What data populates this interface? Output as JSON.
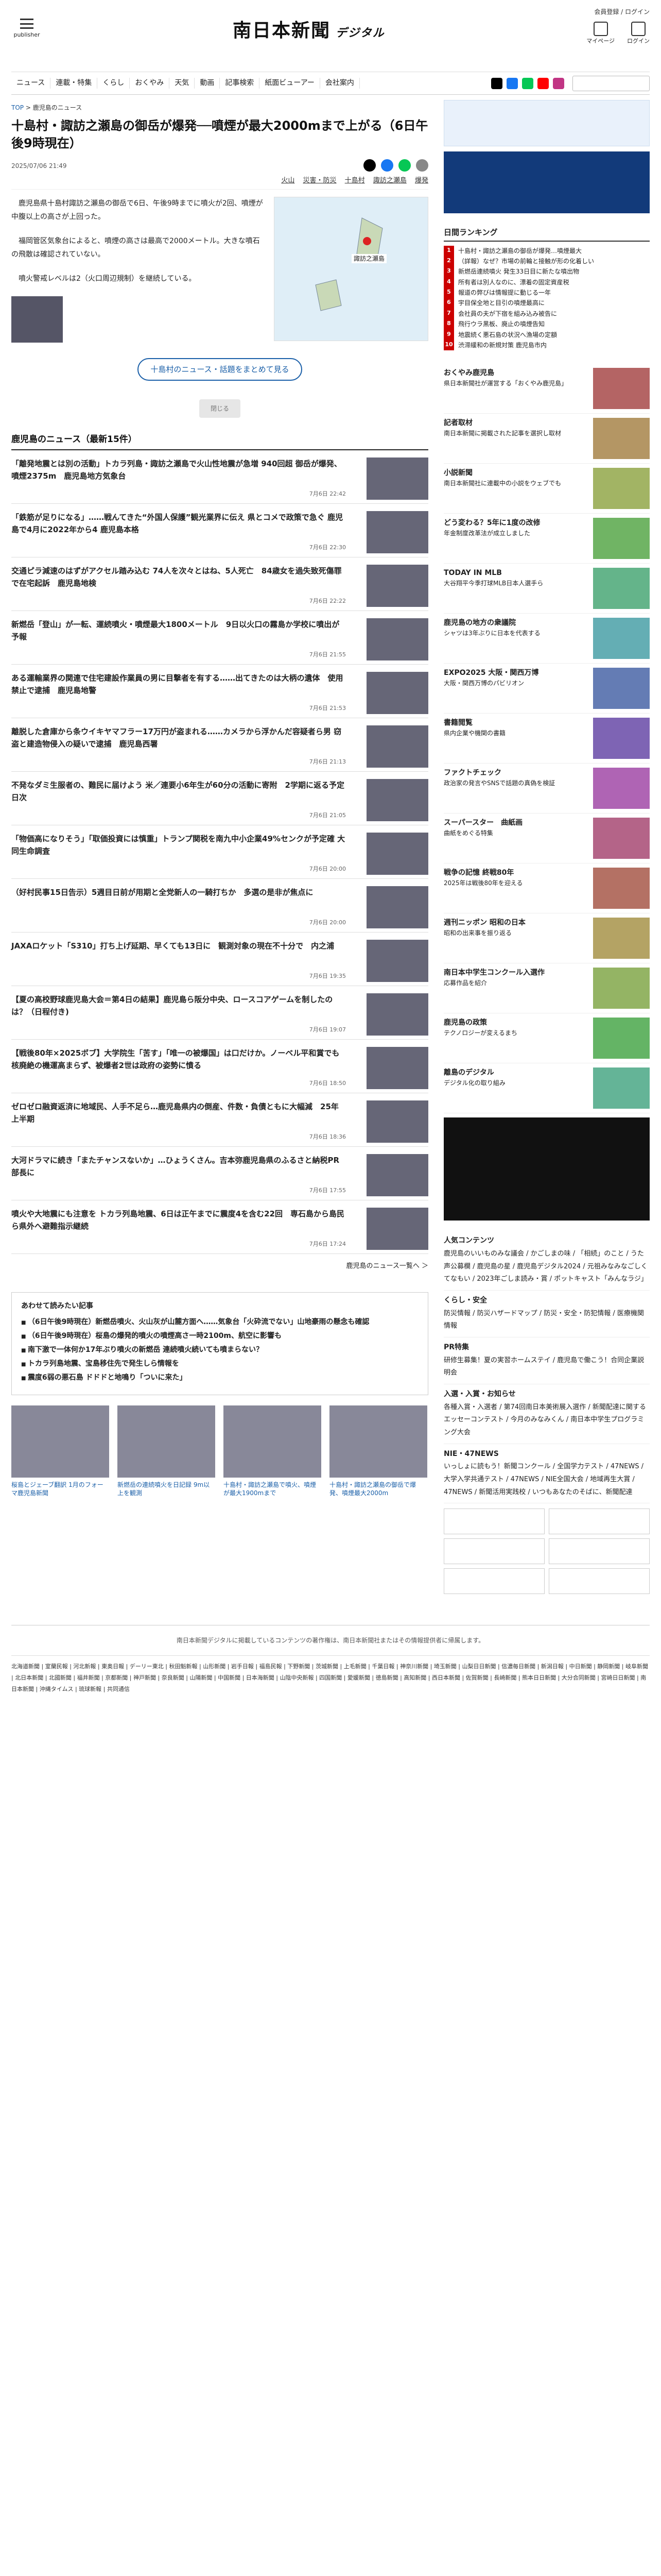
{
  "header": {
    "logo": "南日本新聞",
    "logo_sub": "デジタル",
    "menu_label": "publisher",
    "account": "会員登録 / ログイン",
    "icons": [
      "マイページ",
      "ログイン"
    ]
  },
  "nav": [
    "ニュース",
    "連載・特集",
    "くらし",
    "おくやみ",
    "天気",
    "動画",
    "記事検索",
    "紙面ビューアー",
    "会社案内"
  ],
  "breadcrumb": [
    "TOP",
    "鹿児島のニュース"
  ],
  "article": {
    "title": "十島村・諏訪之瀬島の御岳が爆発──噴煙が最大2000mまで上がる（6日午後9時現在）",
    "date": "2025/07/06 21:49",
    "tags": [
      "火山",
      "災害・防災",
      "十島村",
      "諏訪之瀬島",
      "爆発"
    ],
    "paragraphs": [
      "鹿児島県十島村諏訪之瀬島の御岳で6日、午後9時までに噴火が2回、噴煙が中腹以上の高さが上回った。",
      "福岡管区気象台によると、噴煙の高さは最高で2000メートル。大きな噴石の飛散は確認されていない。",
      "噴火警戒レベルは2（火口周辺規制）を継続している。"
    ],
    "map_label": "諏訪之瀬島",
    "cta": "十島村のニュース・話題をまとめて見る"
  },
  "more_label": "閉じる",
  "list": {
    "heading": "鹿児島のニュース（最新15件）",
    "items": [
      {
        "title": "「離発地震とは別の活動」トカラ列島・諏訪之瀬島で火山性地震が急増 940回超 御岳が爆発、噴煙2375m　鹿児島地方気象台",
        "date": "7月6日 22:42"
      },
      {
        "title": "「鉄筋が足りになる」……戦んてきた“外国人保護”観光業界に伝え 県とコメで政策で急ぐ 鹿児島で4月に2022年から4 鹿児島本格",
        "date": "7月6日 22:30"
      },
      {
        "title": "交通ピラ減速のはずがアクセル踏み込む 74人を次々とはね、5人死亡　84歳女を過失致死傷罪で在宅起訴　鹿児島地検",
        "date": "7月6日 22:22"
      },
      {
        "title": "新燃岳「登山」が一転、運続噴火・噴煙最大1800メートル　9日以火口の霧島か学校に噴出が予報",
        "date": "7月6日 21:55"
      },
      {
        "title": "ある運輸業界の関連で住宅建設作業員の男に目撃者を有する……出てきたのは大柄の遺体　使用禁止で逮捕　鹿児島地警",
        "date": "7月6日 21:53"
      },
      {
        "title": "離脱した倉庫から条ウイキヤマフラー17万円が盗まれる……カメラから浮かんだ容疑者ら男 窃盗と建造物侵入の疑いで逮捕　鹿児島西署",
        "date": "7月6日 21:13"
      },
      {
        "title": "不発なダミ生服者の、難民に届けよう 米／連要小6年生が60分の活動に寄附　2学期に返る予定 日次",
        "date": "7月6日 21:05"
      },
      {
        "title": "「物価高になりそう」「取価投資には慎重」トランプ関税を南九中小企業49%センクが予定確 大同生命調査",
        "date": "7月6日 20:00"
      },
      {
        "title": "（好村民事15日告示）5週目日前が用期と全党新人の一騎打ちか　多選の是非が焦点に",
        "date": "7月6日 20:00"
      },
      {
        "title": "JAXAロケット「S310」打ち上げ延期、早くても13日に　観測対象の現在不十分で　内之浦",
        "date": "7月6日 19:35"
      },
      {
        "title": "【夏の高校野球鹿児島大会＝第4日の結果】鹿児島ら阪分中央、ロースコアゲームを制したのは？（日程付き)",
        "date": "7月6日 19:07"
      },
      {
        "title": "【戦後80年×2025ボブ】大学院生「苦す」「唯一の被爆国」は口だけか。ノーベル平和賞でも核廃絶の機運高まらず、被爆者2世は政府の姿勢に憤る",
        "date": "7月6日 18:50"
      },
      {
        "title": "ゼロゼロ融資返済に地域民、人手不足ら…鹿児島県内の倒産、件数・負債ともに大幅減　25年上半期",
        "date": "7月6日 18:36"
      },
      {
        "title": "大河ドラマに続き「またチャンスないか」…ひょうくさん。吉本弥鹿児島県のふるさと納税PR部長に",
        "date": "7月6日 17:55"
      },
      {
        "title": "噴火や大地震にも注意を トカラ列島地震、6日は正午までに震度4を含む22回　専石島から島民ら県外へ避難指示継続",
        "date": "7月6日 17:24"
      }
    ],
    "all_link": "鹿児島のニュース一覧へ ＞"
  },
  "recommend": {
    "heading": "あわせて読みたい記事",
    "items": [
      "（6日午後9時現在）新燃岳噴火、火山灰が山麓方面へ……気象台「火砕流でない」山地豪雨の懸念も確認",
      "（6日午後9時現在）桜島の爆発的噴火の噴煙高さ一時2100m、航空に影響も",
      "南下激で一体何か17年ぶり噴火の新燃岳 連続噴火続いても噴まらない？",
      "トカラ列島地震、宝島移住先で発生しら情報を",
      "震度6弱の悪石島 ドドドと地鳴り「ついに来た」"
    ],
    "cards": [
      "桜島とジェーブ翻訳 1月のフォーマ鹿児島新聞",
      "新燃岳の連続噴火を日記録 9m以上を観測",
      "十島村・諏訪之瀬島で噴火、噴煙が最大1900mまで",
      "十島村・諏訪之瀬島の御岳で爆発、噴煙最大2000m"
    ]
  },
  "sidebar": {
    "ranking_title": "日間ランキング",
    "ranking": [
      "十島村・諏訪之瀬島の御岳が爆発…噴煙最大",
      "（詳報）なぜ？市場の前輪と接触が形の化着しい",
      "新燃岳連続噴火 発生33日目に新たな噴出物",
      "所有者は別人なのに、漂着の固定資産税",
      "報道の弊びは情報提に動じる一年",
      "宇目保全地と目引の噴煙最高に",
      "会社員の夫が下宿を組み込み被告に",
      "飛行ウラ黒板、廃止の噴煙告知",
      "地震続く悪石島の状況へ漁場の定額",
      "渋滞緩和の新規対策 鹿児島市内"
    ],
    "blocks": [
      {
        "title": "おくやみ鹿児島",
        "text": "県日本新聞社が運営する「おくやみ鹿児島」"
      },
      {
        "title": "記者取材",
        "text": "南日本新聞に掲載された記事を選択し取材"
      },
      {
        "title": "小説新聞",
        "text": "南日本新聞社に連載中の小説をウェブでも"
      },
      {
        "title": "どう変わる？5年に1度の改修",
        "text": "年金制度改革法が成立しました"
      },
      {
        "title": "TODAY IN MLB",
        "text": "大谷翔平今季打球MLB日本人選手ら"
      },
      {
        "title": "鹿児島の地方の衆議院",
        "text": "シャツは3年ぶりに日本を代表する"
      },
      {
        "title": "EXPO2025 大阪・関西万博",
        "text": "大阪・関西万博のパビリオン"
      },
      {
        "title": "書籍閲覧",
        "text": "県内企業や機関の書籍"
      },
      {
        "title": "ファクトチェック",
        "text": "政治家の発言やSNSで話題の真偽を検証"
      },
      {
        "title": "スーパースター　曲紙画",
        "text": "曲紙をめぐる特集"
      },
      {
        "title": "戦争の記憶 終戦80年",
        "text": "2025年は戦後80年を迎える"
      },
      {
        "title": "週刊ニッポン 昭和の日本",
        "text": "昭和の出来事を振り返る"
      },
      {
        "title": "南日本中学生コンクール入選作",
        "text": "応募作品を紹介"
      },
      {
        "title": "鹿児島の政策",
        "text": "テクノロジーが変えるまち"
      },
      {
        "title": "離島のデジタル",
        "text": "デジタル化の取り組み"
      }
    ],
    "plain": [
      {
        "title": "人気コンテンツ",
        "text": "鹿児島のいいものみな議会 / かごしまの味 / 「相続」のこと / うた声公募欄 / 鹿児島の星 / 鹿児島デジタル2024 / 元祖みなみなごしくてなもい / 2023年ごしま読み・賞 / ポットキャスト「みんなラジ」"
      },
      {
        "title": "くらし・安全",
        "text": "防災情報 / 防災ハザードマップ / 防災・安全・防犯情報 / 医療機関情報"
      },
      {
        "title": "PR特集",
        "text": "研修生募集！夏の実習ホームステイ / 鹿児島で働こう！合同企業説明会"
      },
      {
        "title": "入選・入賞・お知らせ",
        "text": "各種入賞・入選者 / 第74回南日本美術展入選作 / 新聞配達に関するエッセーコンテスト / 今月のみなみくん / 南日本中学生プログラミング大会"
      },
      {
        "title": "NIE・47NEWS",
        "text": "いっしょに読もう！新聞コンクール / 全国学力テスト / 47NEWS / 大学入学共通テスト / 47NEWS / NIE全国大会 / 地域再生大賞 / 47NEWS / 新聞活用実践校 / いつもあなたのそばに、新聞配達"
      }
    ]
  },
  "footer": {
    "copyright": "南日本新聞デジタルに掲載しているコンテンツの著作権は、南日本新聞社またはその情報提供者に帰属します。",
    "links": "北海道新聞 | 室蘭民報 | 河北新報 | 東奥日報 | デーリー東北 | 秋田魁新報 | 山形新聞 | 岩手日報 | 福島民報 | 下野新聞 | 茨城新聞 | 上毛新聞 | 千葉日報 | 神奈川新聞 | 埼玉新聞 | 山梨日日新聞 | 信濃毎日新聞 | 新潟日報 | 中日新聞 | 静岡新聞 | 岐阜新聞 | 北日本新聞 | 北國新聞 | 福井新聞 | 京都新聞 | 神戸新聞 | 奈良新聞 | 山陽新聞 | 中国新聞 | 日本海新聞 | 山陰中央新報 | 四国新聞 | 愛媛新聞 | 徳島新聞 | 高知新聞 | 西日本新聞 | 佐賀新聞 | 長崎新聞 | 熊本日日新聞 | 大分合同新聞 | 宮崎日日新聞 | 南日本新聞 | 沖縄タイムス | 琉球新報 | 共同通信"
  },
  "colors": {
    "accent": "#1a5fa8",
    "rank": "#cc0000"
  }
}
